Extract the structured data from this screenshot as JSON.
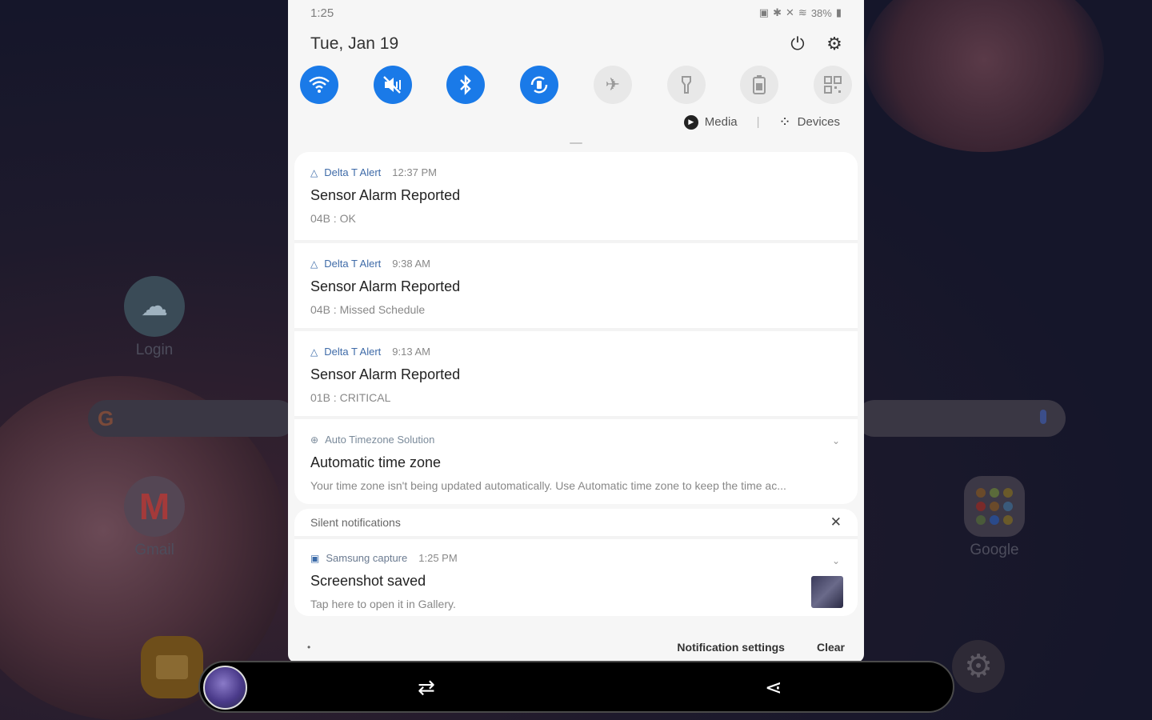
{
  "status_bar": {
    "time": "1:25",
    "icons": [
      "nfc-icon",
      "bluetooth-icon",
      "mute-icon",
      "wifi-icon"
    ],
    "battery": "38%"
  },
  "header": {
    "date": "Tue, Jan 19",
    "power_icon": "power-icon",
    "settings_icon": "gear-icon"
  },
  "quick_settings": [
    {
      "name": "wifi",
      "state": "on"
    },
    {
      "name": "mute",
      "state": "on"
    },
    {
      "name": "bluetooth",
      "state": "on"
    },
    {
      "name": "auto-rotate",
      "state": "on"
    },
    {
      "name": "airplane-mode",
      "state": "off"
    },
    {
      "name": "flashlight",
      "state": "off"
    },
    {
      "name": "power-saving",
      "state": "off"
    },
    {
      "name": "qr-scanner",
      "state": "off"
    }
  ],
  "media_row": {
    "media_label": "Media",
    "devices_label": "Devices"
  },
  "notifications": [
    {
      "app": "Delta T Alert",
      "time": "12:37 PM",
      "title": "Sensor Alarm Reported",
      "body": "04B : OK"
    },
    {
      "app": "Delta T Alert",
      "time": "9:38 AM",
      "title": "Sensor Alarm Reported",
      "body": "04B : Missed Schedule"
    },
    {
      "app": "Delta T Alert",
      "time": "9:13 AM",
      "title": "Sensor Alarm Reported",
      "body": "01B : CRITICAL"
    }
  ],
  "timezone_notification": {
    "app": "Auto Timezone Solution",
    "title": "Automatic time zone",
    "body": "Your time zone isn't being updated automatically. Use Automatic time zone to keep the time ac..."
  },
  "silent": {
    "label": "Silent notifications",
    "capture": {
      "app": "Samsung capture",
      "time": "1:25 PM",
      "title": "Screenshot saved",
      "body": "Tap here to open it in Gallery."
    }
  },
  "footer": {
    "settings_label": "Notification settings",
    "clear_label": "Clear"
  },
  "home_screen": {
    "login_label": "Login",
    "gmail_label": "Gmail",
    "google_label": "Google"
  },
  "colors": {
    "accent": "#1a7ae8",
    "app_name": "#3f6ba8",
    "panel_bg": "#f6f6f6"
  }
}
